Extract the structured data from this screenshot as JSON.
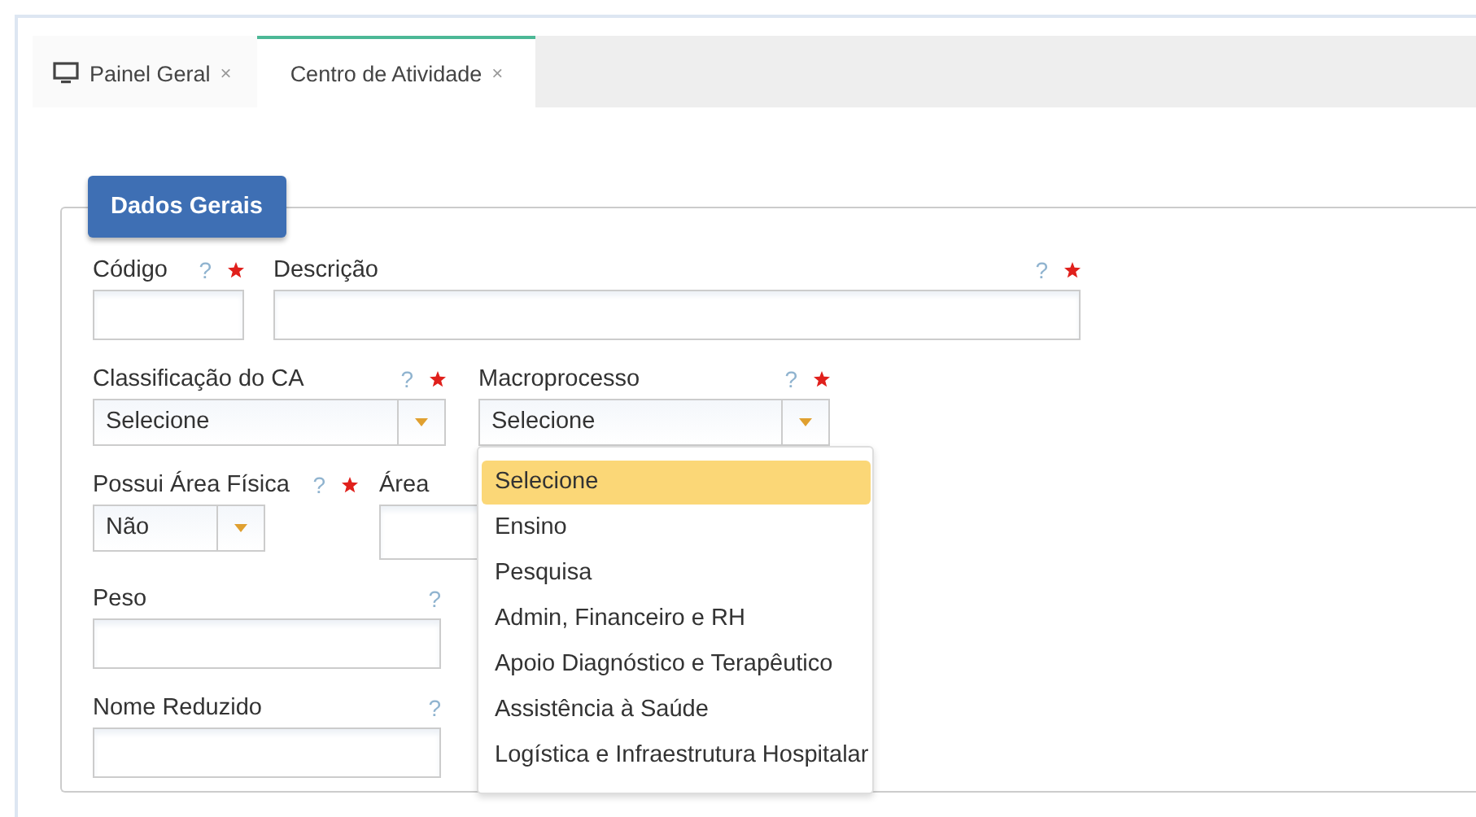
{
  "tabs": [
    {
      "label": "Painel Geral",
      "close": "×",
      "selected": false
    },
    {
      "label": "Centro de Atividade",
      "close": "×",
      "selected": true
    }
  ],
  "panel": {
    "legend": "Dados Gerais",
    "rows": [
      [
        {
          "label": "Código",
          "kind": "text",
          "help": "?",
          "required": true
        },
        {
          "label": "Descrição",
          "kind": "text",
          "help": "?",
          "required": true
        }
      ],
      [
        {
          "label": "Classificação do CA",
          "kind": "select",
          "value": "Selecione",
          "help": "?",
          "required": true
        },
        {
          "label": "Macroprocesso",
          "kind": "select",
          "value": "Selecione",
          "help": "?",
          "required": true,
          "expanded": true
        }
      ],
      [
        {
          "label": "Possui Área Física",
          "kind": "select",
          "value": "Não",
          "help": "?",
          "required": true
        },
        {
          "label": "Área",
          "kind": "text",
          "required": false
        }
      ],
      [
        {
          "label": "Peso",
          "kind": "text",
          "help": "?",
          "required": false
        }
      ],
      [
        {
          "label": "Nome Reduzido",
          "kind": "text",
          "help": "?",
          "required": false
        }
      ]
    ],
    "open_menu": {
      "options": [
        {
          "label": "Selecione",
          "selected": true
        },
        {
          "label": "Ensino",
          "selected": false
        },
        {
          "label": "Pesquisa",
          "selected": false
        },
        {
          "label": "Admin, Financeiro e RH",
          "selected": false
        },
        {
          "label": "Apoio Diagnóstico e Terapêutico",
          "selected": false
        },
        {
          "label": "Assistência à Saúde",
          "selected": false
        },
        {
          "label": "Logística e Infraestrutura Hospitalar",
          "selected": false
        }
      ]
    }
  }
}
